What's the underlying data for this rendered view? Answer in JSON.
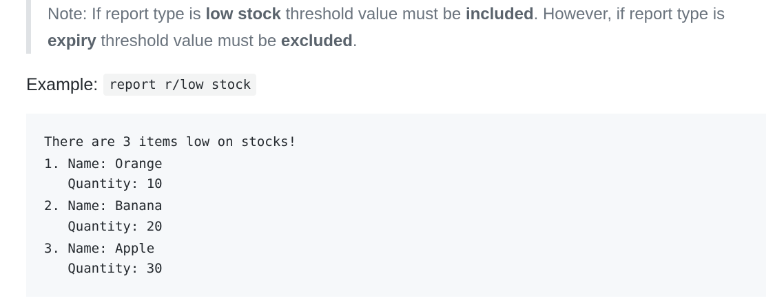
{
  "note": {
    "line1": {
      "t1": "Note: If report type is ",
      "b1": "low stock",
      "t2": " threshold value must be ",
      "b2": "included",
      "t3": ". However, if report type is"
    },
    "line2": {
      "b1": "expiry",
      "t1": " threshold value must be ",
      "b2": "excluded",
      "t2": "."
    }
  },
  "example": {
    "label": "Example:",
    "command": "report r/low stock"
  },
  "output": {
    "header": "There are 3 items low on stocks!",
    "items": [
      {
        "name_line": "1. Name: Orange",
        "qty_line": "   Quantity: 10"
      },
      {
        "name_line": "2. Name: Banana",
        "qty_line": "   Quantity: 20"
      },
      {
        "name_line": "3. Name: Apple",
        "qty_line": "   Quantity: 30"
      }
    ]
  }
}
